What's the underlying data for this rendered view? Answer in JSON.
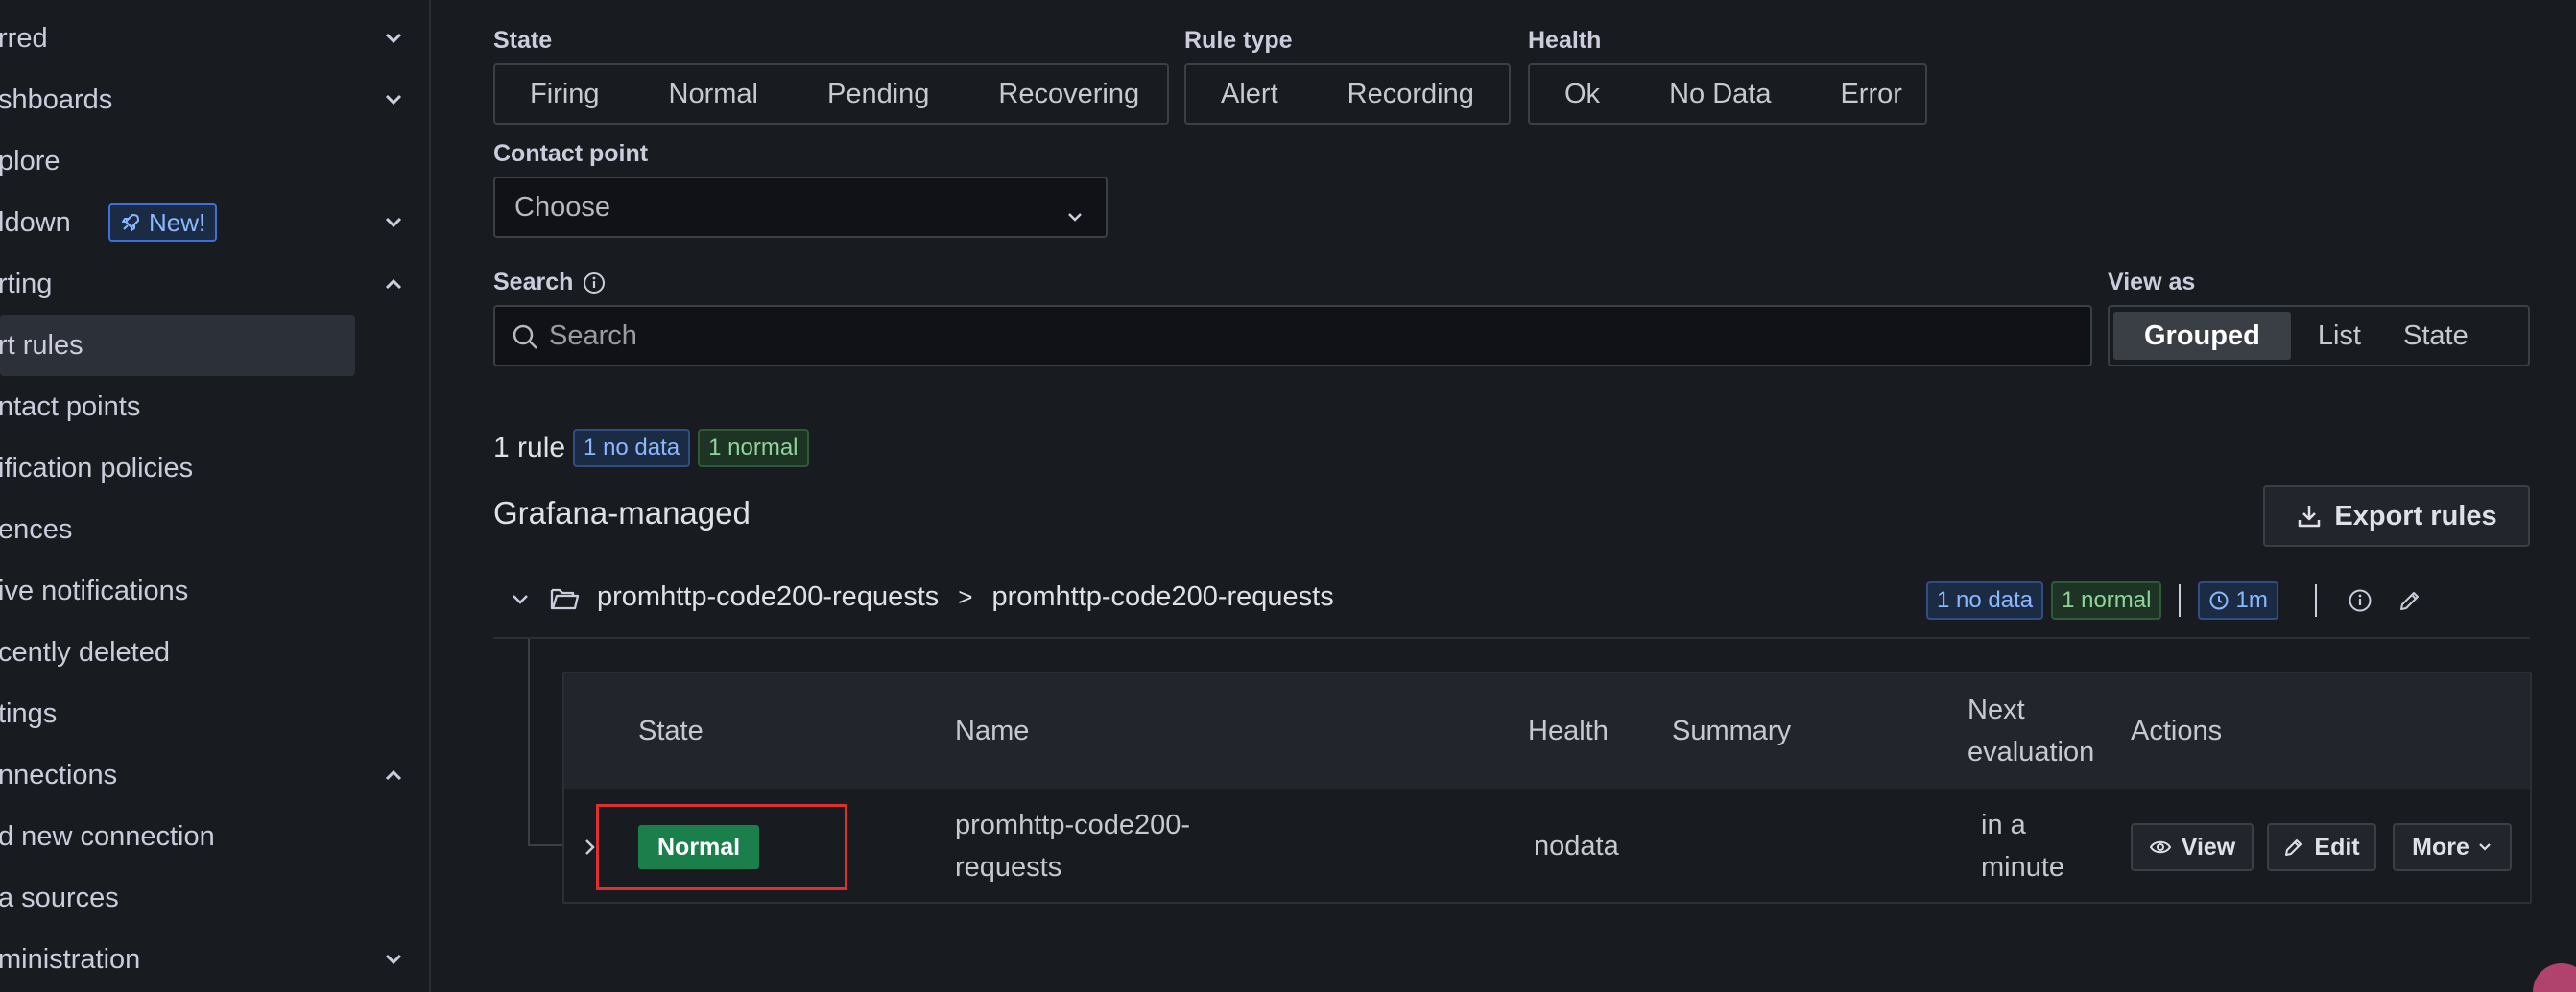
{
  "sidebar": {
    "items": [
      {
        "label": "rred",
        "chevron": "down"
      },
      {
        "label": "shboards",
        "chevron": "down"
      },
      {
        "label": "plore",
        "chevron": ""
      },
      {
        "label": "ldown",
        "chevron": "down",
        "badge": "New!"
      },
      {
        "label": "rting",
        "chevron": "up"
      },
      {
        "label": "rt rules",
        "chevron": "",
        "active": true
      },
      {
        "label": "ntact points",
        "chevron": ""
      },
      {
        "label": "ification policies",
        "chevron": ""
      },
      {
        "label": "ences",
        "chevron": ""
      },
      {
        "label": "ive notifications",
        "chevron": ""
      },
      {
        "label": "cently deleted",
        "chevron": ""
      },
      {
        "label": "tings",
        "chevron": ""
      },
      {
        "label": "nnections",
        "chevron": "up"
      },
      {
        "label": "d new connection",
        "chevron": ""
      },
      {
        "label": "a sources",
        "chevron": ""
      },
      {
        "label": "ministration",
        "chevron": "down"
      }
    ]
  },
  "filters": {
    "state": {
      "label": "State",
      "options": [
        "Firing",
        "Normal",
        "Pending",
        "Recovering"
      ]
    },
    "rule_type": {
      "label": "Rule type",
      "options": [
        "Alert",
        "Recording"
      ]
    },
    "health": {
      "label": "Health",
      "options": [
        "Ok",
        "No Data",
        "Error"
      ]
    },
    "contact_point": {
      "label": "Contact point",
      "value": "Choose"
    },
    "search": {
      "label": "Search",
      "placeholder": "Search"
    },
    "view_as": {
      "label": "View as",
      "options": [
        "Grouped",
        "List",
        "State"
      ],
      "selected": "Grouped"
    }
  },
  "summary": {
    "count_text": "1 rule",
    "nodata_badge": "1 no data",
    "normal_badge": "1 normal"
  },
  "section": {
    "title": "Grafana-managed",
    "export_label": "Export rules"
  },
  "group": {
    "folder": "promhttp-code200-requests",
    "separator": ">",
    "name": "promhttp-code200-requests",
    "nodata_badge": "1 no data",
    "normal_badge": "1 normal",
    "interval": "1m"
  },
  "table": {
    "headers": {
      "state": "State",
      "name": "Name",
      "health": "Health",
      "summary": "Summary",
      "next_eval_1": "Next",
      "next_eval_2": "evaluation",
      "actions": "Actions"
    },
    "row": {
      "state": "Normal",
      "name_1": "promhttp-code200-",
      "name_2": "requests",
      "health": "nodata",
      "summary": "",
      "next_1": "in a",
      "next_2": "minute",
      "view": "View",
      "edit": "Edit",
      "more": "More"
    }
  },
  "colors": {
    "accent_blue": "#3d71d9",
    "normal_green": "#1a7f4b",
    "highlight_red": "#e02f2f"
  }
}
